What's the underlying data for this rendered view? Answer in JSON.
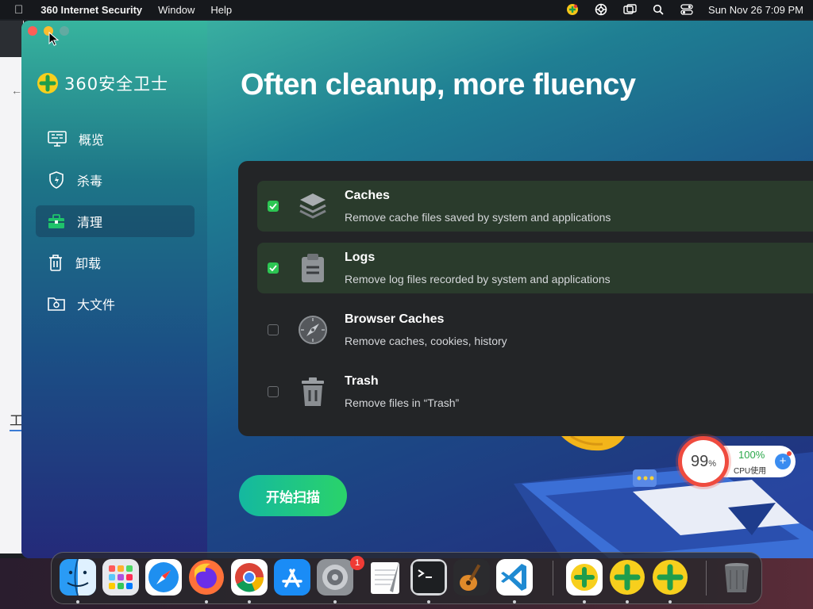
{
  "menubar": {
    "app_name": "360 Internet Security",
    "menus": [
      "Window",
      "Help"
    ],
    "clock": "Sun Nov 26  7:09 PM"
  },
  "background_window": {
    "fragment_text": "工"
  },
  "app": {
    "logo_text": "360安全卫士",
    "headline": "Often cleanup, more fluency",
    "nav": [
      {
        "label": "概览",
        "icon": "monitor-icon",
        "active": false
      },
      {
        "label": "杀毒",
        "icon": "shield-icon",
        "active": false
      },
      {
        "label": "清理",
        "icon": "toolbox-icon",
        "active": true
      },
      {
        "label": "卸载",
        "icon": "trash-icon",
        "active": false
      },
      {
        "label": "大文件",
        "icon": "folder-icon",
        "active": false
      }
    ],
    "items": [
      {
        "title": "Caches",
        "description": "Remove cache files saved by system and applications",
        "checked": true,
        "icon": "layers-icon"
      },
      {
        "title": "Logs",
        "description": "Remove log files recorded by system and applications",
        "checked": true,
        "icon": "clipboard-icon"
      },
      {
        "title": "Browser Caches",
        "description": "Remove caches, cookies, history",
        "checked": false,
        "icon": "compass-icon"
      },
      {
        "title": "Trash",
        "description": "Remove files in “Trash”",
        "checked": false,
        "icon": "trash-icon"
      }
    ],
    "scan_button": "开始扫描"
  },
  "cpu_widget": {
    "memory_value": "99",
    "memory_unit": "%",
    "cpu_value": "100%",
    "cpu_label": "CPU使用"
  },
  "dock": {
    "items": [
      {
        "name": "finder-icon",
        "running": true
      },
      {
        "name": "launchpad-icon",
        "running": false
      },
      {
        "name": "safari-icon",
        "running": false
      },
      {
        "name": "firefox-icon",
        "running": true
      },
      {
        "name": "chrome-icon",
        "running": true
      },
      {
        "name": "app-store-icon",
        "running": false
      },
      {
        "name": "system-settings-icon",
        "running": true,
        "badge": "1"
      },
      {
        "name": "textedit-icon",
        "running": false
      },
      {
        "name": "terminal-icon",
        "running": true
      },
      {
        "name": "garageband-icon",
        "running": false
      },
      {
        "name": "vscode-icon",
        "running": true
      },
      {
        "name": "360-security-icon",
        "running": true
      },
      {
        "name": "360-plus-icon",
        "running": true
      },
      {
        "name": "360-plus-alt-icon",
        "running": true
      },
      {
        "name": "trash-bin-icon",
        "running": false
      }
    ]
  },
  "colors": {
    "accent_green": "#2dc653",
    "scan_gradient_start": "#14b8a0",
    "scan_gradient_end": "#2ad36a",
    "alert_red": "#ef4b3f"
  }
}
